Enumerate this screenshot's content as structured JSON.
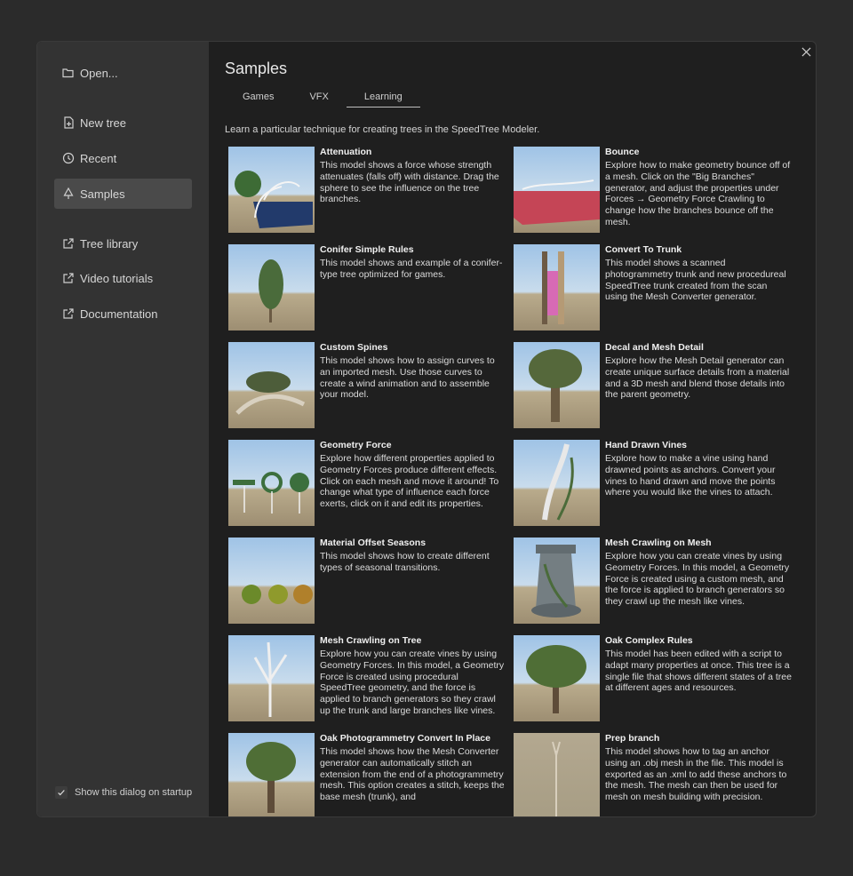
{
  "sidebar": {
    "items": [
      {
        "label": "Open...",
        "icon": "folder-open-icon"
      },
      {
        "label": "New tree",
        "icon": "new-file-icon"
      },
      {
        "label": "Recent",
        "icon": "clock-icon"
      },
      {
        "label": "Samples",
        "icon": "tree-icon"
      },
      {
        "label": "Tree library",
        "icon": "external-link-icon"
      },
      {
        "label": "Video tutorials",
        "icon": "external-link-icon"
      },
      {
        "label": "Documentation",
        "icon": "external-link-icon"
      }
    ],
    "startup_label": "Show this dialog on startup",
    "startup_checked": true
  },
  "main": {
    "title": "Samples",
    "tabs": [
      "Games",
      "VFX",
      "Learning"
    ],
    "active_tab": "Learning",
    "description": "Learn a particular technique for creating trees in the SpeedTree Modeler."
  },
  "samples": [
    {
      "title": "Attenuation",
      "desc": "This model shows a force whose strength attenuates (falls off) with distance. Drag the sphere to see the influence on the tree branches."
    },
    {
      "title": "Bounce",
      "desc": "Explore how to make geometry bounce off of a mesh. Click on the \"Big Branches\" generator, and adjust the properties under Forces → Geometry Force Crawling to change how the branches bounce off the mesh."
    },
    {
      "title": "Conifer Simple Rules",
      "desc": "This model shows and example of a conifer-type tree optimized for games."
    },
    {
      "title": "Convert To Trunk",
      "desc": "This model shows a scanned photogrammetry trunk and new procedureal SpeedTree trunk created from the scan using the Mesh Converter generator."
    },
    {
      "title": "Custom Spines",
      "desc": "This model shows how to assign curves to an imported mesh. Use those curves to create a wind animation and to assemble your model."
    },
    {
      "title": "Decal and Mesh Detail",
      "desc": "Explore how the Mesh Detail generator can create unique surface details from a material and a 3D mesh and blend those details into the parent geometry."
    },
    {
      "title": "Geometry Force",
      "desc": "Explore how different properties applied to Geometry Forces produce different effects. Click on each mesh and move it around! To change what type of influence each force exerts, click on it and edit its properties."
    },
    {
      "title": "Hand Drawn Vines",
      "desc": "Explore how to make a vine using hand drawned points as anchors. Convert your vines to hand drawn and move the points where you would like the vines to attach."
    },
    {
      "title": "Material Offset Seasons",
      "desc": "This model shows how to create different types of seasonal transitions."
    },
    {
      "title": "Mesh Crawling on Mesh",
      "desc": "Explore how you can create vines by using Geometry Forces. In this model, a Geometry Force is created using a custom mesh, and the force is applied to branch generators so they crawl up the mesh like vines."
    },
    {
      "title": "Mesh Crawling on Tree",
      "desc": "Explore how you can create vines by using Geometry Forces. In this model, a Geometry Force is created using procedural SpeedTree geometry, and the force is applied to branch generators so they crawl up the trunk and large branches like vines."
    },
    {
      "title": "Oak Complex Rules",
      "desc": "This model has been edited with a script to adapt many properties at once. This tree is a single file that shows different states of a tree at different ages and resources."
    },
    {
      "title": "Oak Photogrammetry Convert In Place",
      "desc": "This model shows how the Mesh Converter generator can automatically stitch an extension from the end of a photogrammetry mesh. This option creates a stitch, keeps the base mesh (trunk), and"
    },
    {
      "title": "Prep branch",
      "desc": "This model shows how to tag an anchor using an .obj mesh in the file. This model is exported as an .xml to add these anchors to the mesh. The mesh can then be used for mesh on mesh building with precision."
    }
  ]
}
